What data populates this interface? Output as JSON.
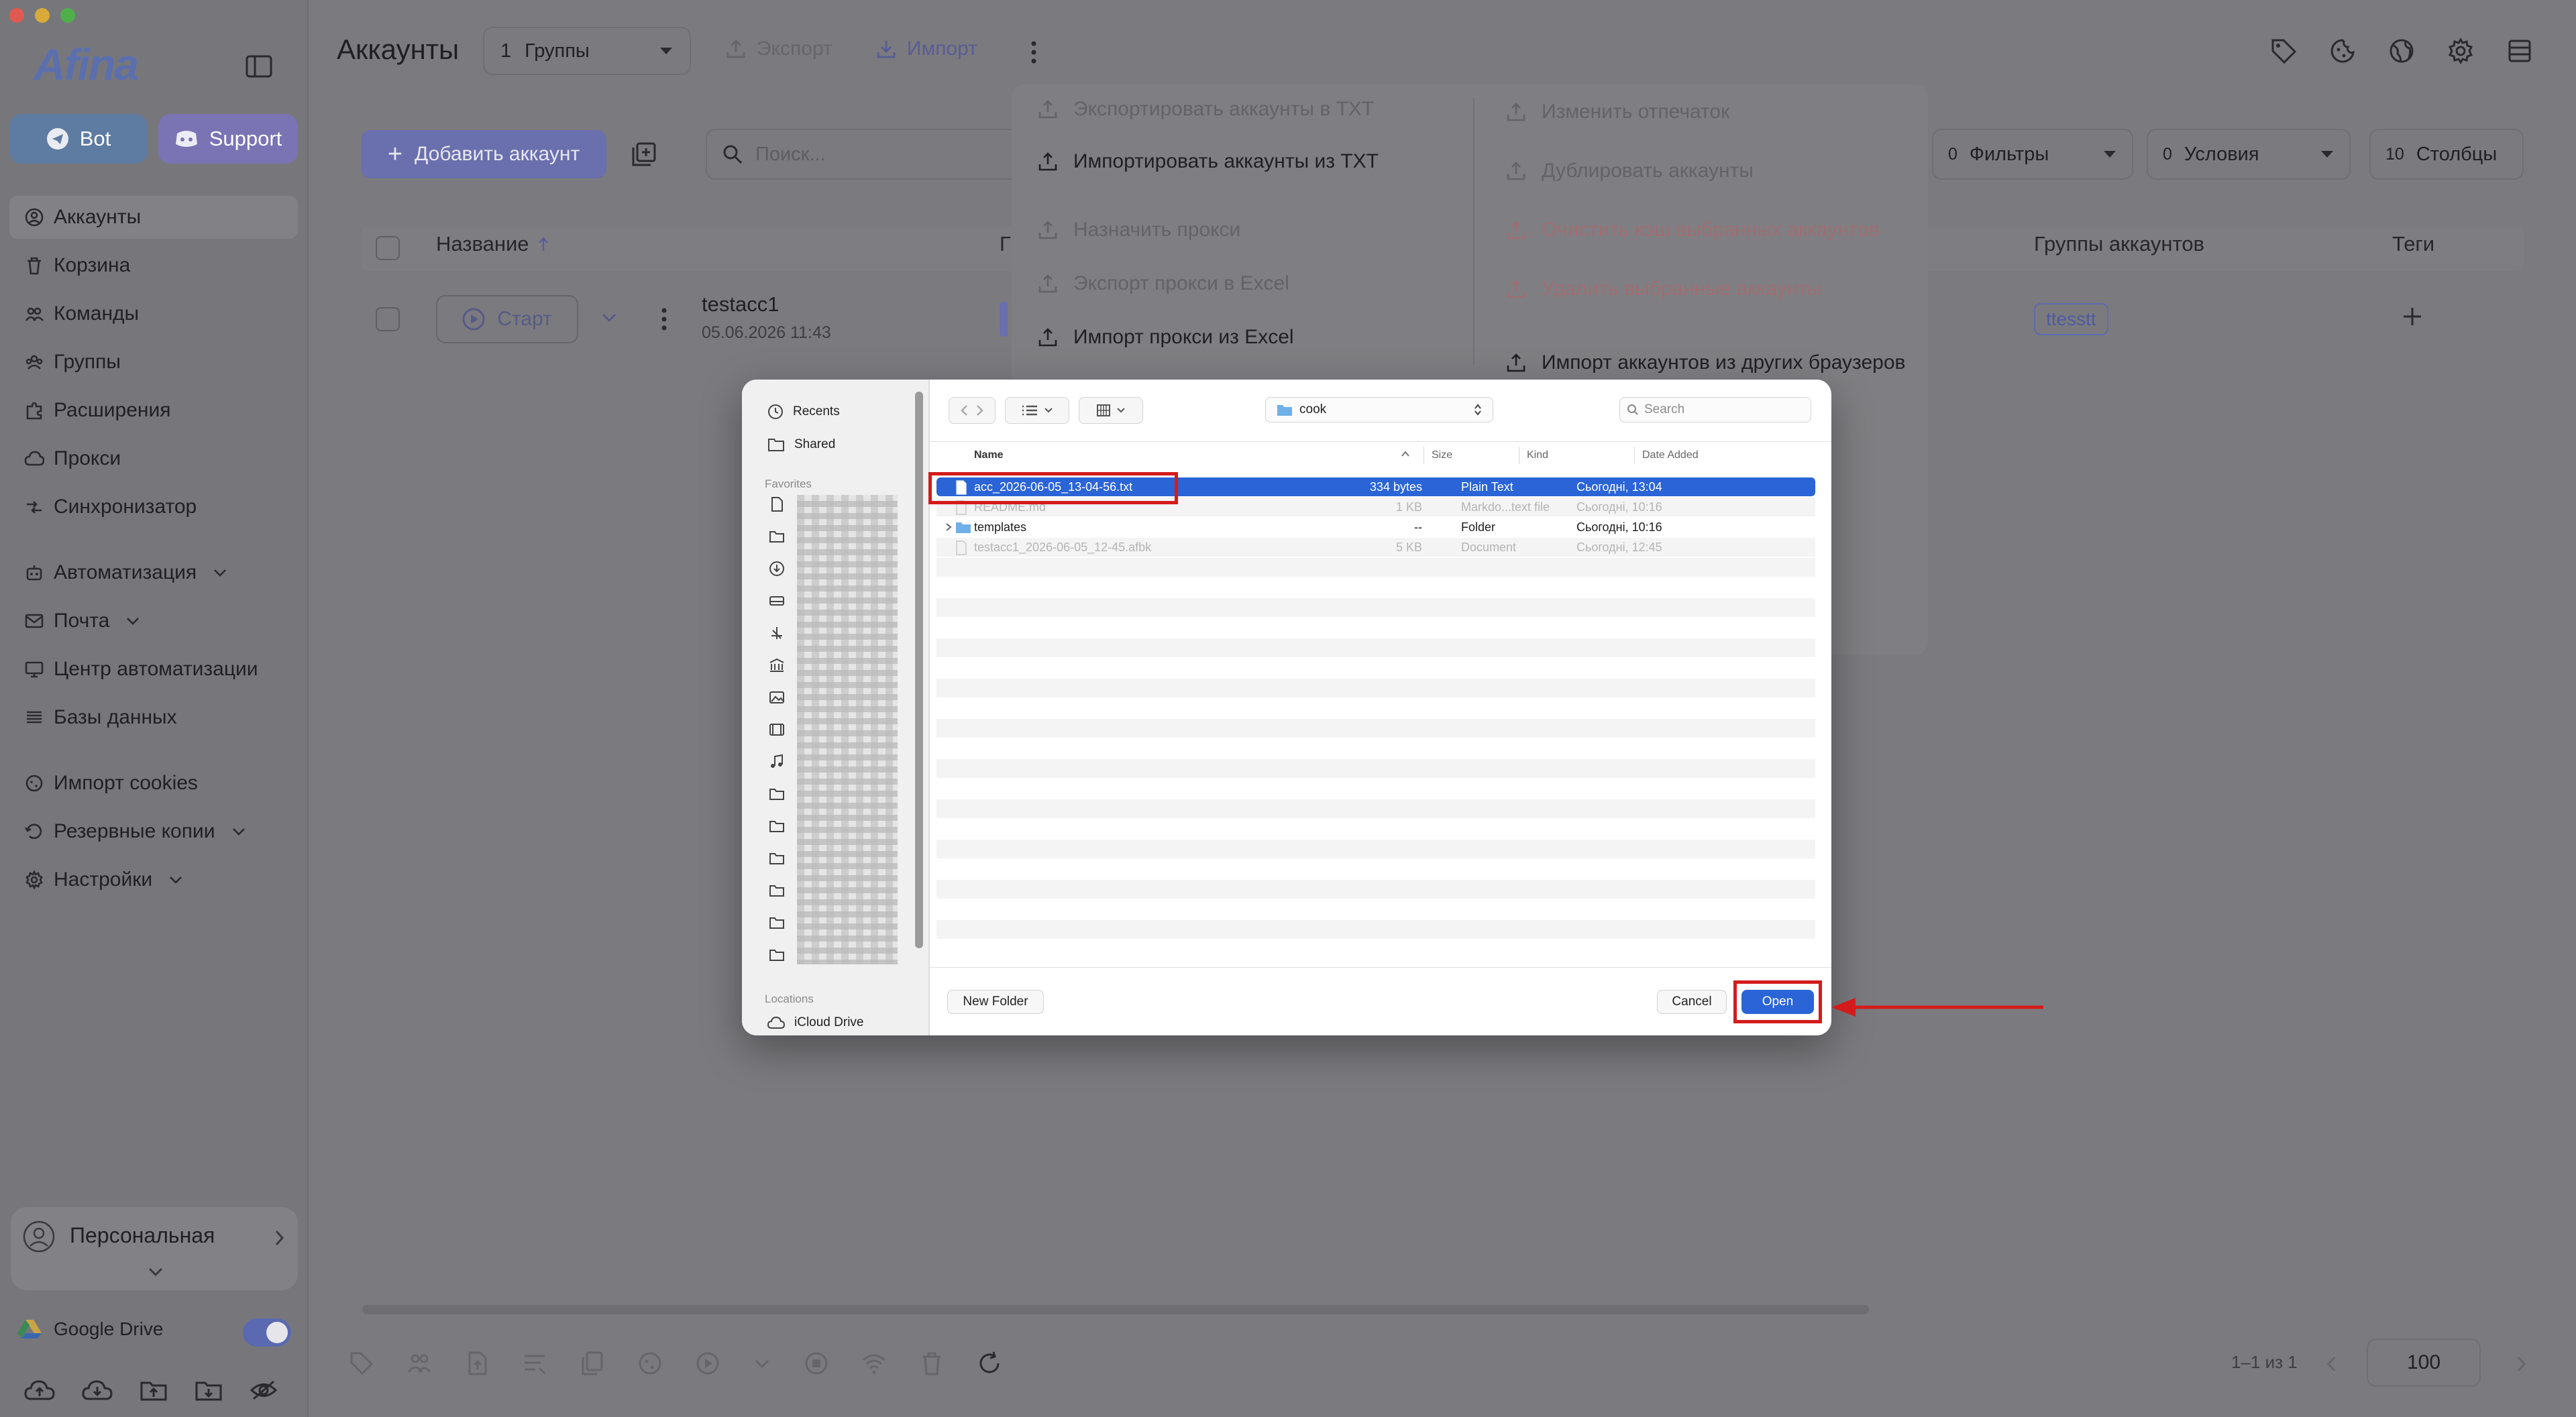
{
  "sidebar": {
    "logo": "Afina",
    "bot_label": "Bot",
    "support_label": "Support",
    "nav": [
      {
        "label": "Аккаунты",
        "icon": "user-circle-icon"
      },
      {
        "label": "Корзина",
        "icon": "trash-icon"
      },
      {
        "label": "Команды",
        "icon": "team-icon"
      },
      {
        "label": "Группы",
        "icon": "group-icon"
      },
      {
        "label": "Расширения",
        "icon": "puzzle-icon"
      },
      {
        "label": "Прокси",
        "icon": "cloud-icon"
      },
      {
        "label": "Синхронизатор",
        "icon": "sync-icon"
      },
      {
        "label": "Автоматизация",
        "icon": "bot-icon"
      },
      {
        "label": "Почта",
        "icon": "mail-icon"
      },
      {
        "label": "Центр автоматизации",
        "icon": "monitor-icon"
      },
      {
        "label": "Базы данных",
        "icon": "database-icon"
      },
      {
        "label": "Импорт cookies",
        "icon": "cookie-icon"
      },
      {
        "label": "Резервные копии",
        "icon": "backup-icon"
      },
      {
        "label": "Настройки",
        "icon": "gear-icon"
      }
    ],
    "profile_label": "Персональная",
    "gdrive_label": "Google Drive"
  },
  "header": {
    "title": "Аккаунты",
    "groups_count": "1",
    "groups_label": "Группы",
    "export_label": "Экспорт",
    "import_label": "Импорт"
  },
  "toolbar": {
    "add_account": "Добавить аккаунт",
    "search_placeholder": "Поиск...",
    "filters_count": "0",
    "filters_label": "Фильтры",
    "conditions_count": "0",
    "conditions_label": "Условия",
    "columns_count": "10",
    "columns_label": "Столбцы"
  },
  "table": {
    "headers": {
      "name": "Название",
      "partial": "Г",
      "groups": "Группы аккаунтов",
      "tags": "Теги"
    },
    "row": {
      "start": "Старт",
      "name": "testacc1",
      "date": "05.06.2026 11:43",
      "group_tag": "ttesstt"
    }
  },
  "menu": {
    "left": [
      {
        "label": "Экспортировать аккаунты в TXT",
        "state": "dim"
      },
      {
        "label": "Импортировать аккаунты из TXT",
        "state": "on"
      },
      {
        "label": "Назначить прокси",
        "state": "dim"
      },
      {
        "label": "Экспорт прокси в Excel",
        "state": "dim"
      },
      {
        "label": "Импорт прокси из Excel",
        "state": "on"
      }
    ],
    "right": [
      {
        "label": "Изменить отпечаток",
        "state": "dim"
      },
      {
        "label": "Дублировать аккаунты",
        "state": "dim"
      },
      {
        "label": "Очистить кэш выбранных аккаунтов",
        "state": "red"
      },
      {
        "label": "Удалить выбранные аккаунты",
        "state": "red"
      },
      {
        "label": "Импорт аккаунтов из других браузеров",
        "state": "on"
      }
    ]
  },
  "footer": {
    "pagination": "1–1 из 1",
    "page_size": "100"
  },
  "dialog": {
    "sidebar": {
      "recents": "Recents",
      "shared": "Shared",
      "favorites_heading": "Favorites",
      "locations_heading": "Locations",
      "icloud": "iCloud Drive"
    },
    "folder": "cook",
    "search_placeholder": "Search",
    "columns": {
      "name": "Name",
      "size": "Size",
      "kind": "Kind",
      "date": "Date Added"
    },
    "files": [
      {
        "name": "acc_2026-06-05_13-04-56.txt",
        "size": "334 bytes",
        "kind": "Plain Text",
        "date": "Сьогодні, 13:04",
        "state": "selected"
      },
      {
        "name": "README.md",
        "size": "1 KB",
        "kind": "Markdo...text file",
        "date": "Сьогодні, 10:16",
        "state": "disabled"
      },
      {
        "name": "templates",
        "size": "--",
        "kind": "Folder",
        "date": "Сьогодні, 10:16",
        "state": "folder"
      },
      {
        "name": "testacc1_2026-06-05_12-45.afbk",
        "size": "5 KB",
        "kind": "Document",
        "date": "Сьогодні, 12:45",
        "state": "disabled"
      }
    ],
    "new_folder": "New Folder",
    "cancel": "Cancel",
    "open": "Open"
  },
  "colors": {
    "accent": "#2a64d6",
    "highlight": "#d41b1b",
    "app_accent": "#6a6fad"
  }
}
